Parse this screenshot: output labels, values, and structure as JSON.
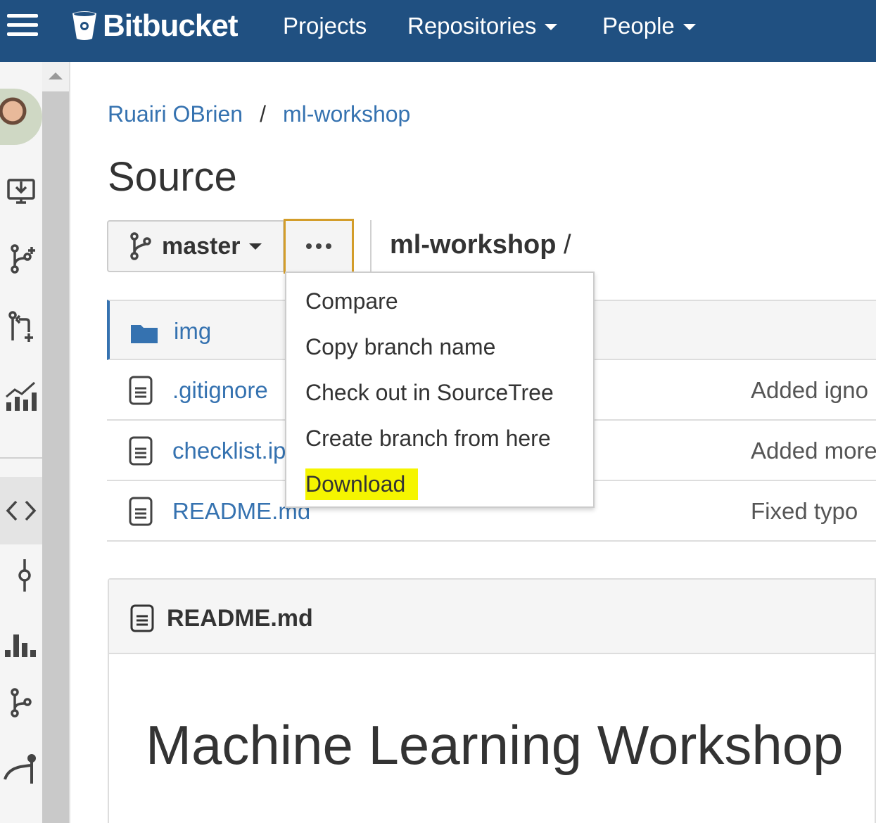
{
  "topbar": {
    "brand": "Bitbucket",
    "nav": [
      {
        "label": "Projects",
        "has_caret": false
      },
      {
        "label": "Repositories",
        "has_caret": true
      },
      {
        "label": "People",
        "has_caret": true
      }
    ],
    "background_color": "#205081"
  },
  "sidebar": {
    "icons": [
      "clone-icon",
      "create-branch-icon",
      "create-pull-request-icon",
      "insights-icon",
      "source-icon",
      "commits-icon",
      "branches-icon",
      "pull-requests-icon",
      "pipelines-icon"
    ],
    "active": "source-icon"
  },
  "breadcrumb": {
    "owner": "Ruairi OBrien",
    "separator": "/",
    "repo": "ml-workshop"
  },
  "page": {
    "title": "Source"
  },
  "toolbar": {
    "branch": "master",
    "repo_path": "ml-workshop",
    "path_separator": "/"
  },
  "dropdown": {
    "items": [
      "Compare",
      "Copy branch name",
      "Check out in SourceTree",
      "Create branch from here",
      "Download"
    ],
    "highlighted": "Download",
    "highlight_color": "#f5f500"
  },
  "files": [
    {
      "type": "folder",
      "name": "img",
      "message": ""
    },
    {
      "type": "file",
      "name": ".gitignore",
      "message": "Added igno"
    },
    {
      "type": "file",
      "name": "checklist.ip",
      "message": "Added more"
    },
    {
      "type": "file",
      "name": "README.md",
      "message": "Fixed typo"
    }
  ],
  "readme": {
    "filename": "README.md",
    "heading": "Machine Learning Workshop"
  },
  "colors": {
    "link": "#3572b0",
    "focus_border": "#d39d2a"
  }
}
